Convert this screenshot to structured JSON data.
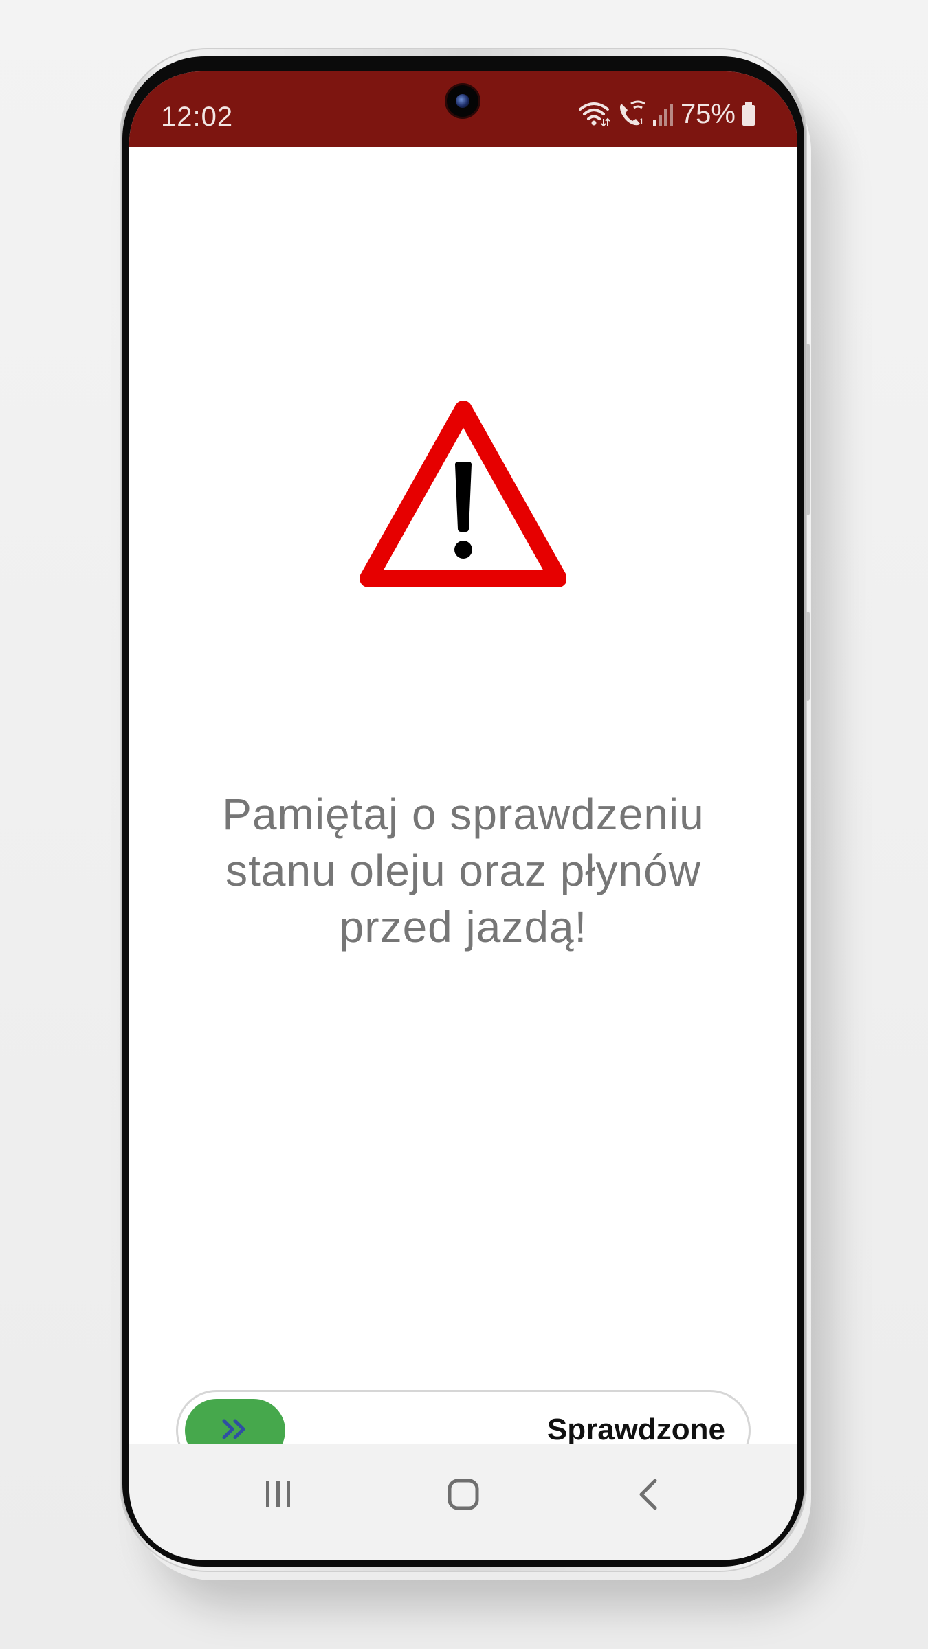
{
  "status_bar": {
    "time": "12:02",
    "battery": "75%",
    "background_color": "#7d1510",
    "icons": [
      "wifi-icon",
      "wifi-call-icon",
      "signal-icon",
      "battery-icon"
    ]
  },
  "warning": {
    "icon": "warning-triangle-icon",
    "color": "#e60000"
  },
  "message": {
    "line1": "Pamiętaj o sprawdzeniu",
    "line2": "stanu oleju oraz płynów",
    "line3": "przed jazdą!"
  },
  "slider": {
    "label": "Sprawdzone",
    "knob_icon": "double-chevron-right-icon",
    "knob_color": "#46a84c",
    "progress": 0
  },
  "nav_bar": {
    "buttons": [
      "recent-apps-icon",
      "home-icon",
      "back-icon"
    ]
  }
}
